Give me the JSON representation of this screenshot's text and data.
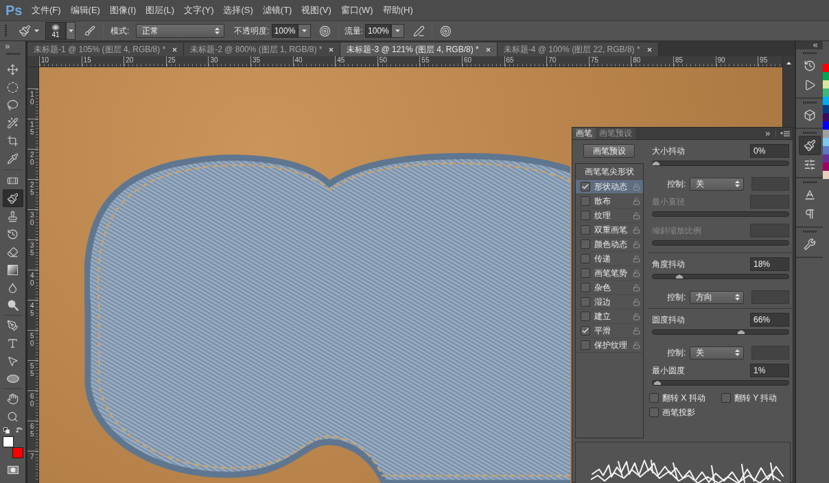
{
  "app": {
    "logo": "Ps"
  },
  "menu": [
    "文件(F)",
    "编辑(E)",
    "图像(I)",
    "图层(L)",
    "文字(Y)",
    "选择(S)",
    "滤镜(T)",
    "视图(V)",
    "窗口(W)",
    "帮助(H)"
  ],
  "options_bar": {
    "brush_size": "41",
    "mode": {
      "label": "模式:",
      "value": "正常"
    },
    "opacity": {
      "label": "不透明度:",
      "value": "100%"
    },
    "flow": {
      "label": "流量:",
      "value": "100%"
    }
  },
  "document_tabs": [
    {
      "title": "未标题-1 @ 105% (图层 4, RGB/8) *",
      "selected": false
    },
    {
      "title": "未标题-2 @ 800% (图层 1, RGB/8) *",
      "selected": false
    },
    {
      "title": "未标题-3 @ 121% (图层 4, RGB/8) *",
      "selected": true
    },
    {
      "title": "未标题-4 @ 100% (图层 22, RGB/8) *",
      "selected": false
    }
  ],
  "rulers": {
    "horizontal": [
      "10",
      "15",
      "20",
      "25",
      "30",
      "35",
      "40",
      "45",
      "50",
      "55",
      "60",
      "65",
      "70",
      "75",
      "80",
      "85",
      "90",
      "95"
    ],
    "vertical": [
      "10",
      "15",
      "20",
      "25",
      "30",
      "35",
      "40",
      "45",
      "50",
      "55",
      "60",
      "65",
      "7"
    ]
  },
  "tool_groups": [
    {
      "tools": [
        {
          "kind": "move",
          "selected": false
        },
        {
          "kind": "marquee",
          "selected": false
        },
        {
          "kind": "lasso",
          "selected": false
        },
        {
          "kind": "quick_selection",
          "selected": false
        },
        {
          "kind": "crop",
          "selected": false
        },
        {
          "kind": "eyedropper",
          "selected": false
        }
      ]
    },
    {
      "tools": [
        {
          "kind": "healing",
          "selected": false
        },
        {
          "kind": "brush",
          "selected": true
        },
        {
          "kind": "stamp",
          "selected": false
        },
        {
          "kind": "history_brush",
          "selected": false
        },
        {
          "kind": "eraser",
          "selected": false
        },
        {
          "kind": "gradient",
          "selected": false
        },
        {
          "kind": "blur",
          "selected": false
        },
        {
          "kind": "dodge",
          "selected": false
        }
      ]
    },
    {
      "tools": [
        {
          "kind": "pen",
          "selected": false
        },
        {
          "kind": "type",
          "selected": false
        },
        {
          "kind": "path_selection",
          "selected": false
        },
        {
          "kind": "ellipse",
          "selected": false
        }
      ]
    },
    {
      "tools": [
        {
          "kind": "hand",
          "selected": false
        },
        {
          "kind": "zoom",
          "selected": false
        }
      ]
    }
  ],
  "colors": {
    "foreground": {
      "color": "#ffffff"
    },
    "background": {
      "color": "#ff0000"
    }
  },
  "dock_groups": [
    {
      "items": [
        {
          "kind": "history",
          "selected": false
        },
        {
          "kind": "actions",
          "selected": false
        }
      ]
    },
    {
      "items": [
        {
          "kind": "model",
          "selected": false
        }
      ]
    },
    {
      "items": [
        {
          "kind": "brush",
          "selected": true
        },
        {
          "kind": "brush_presets",
          "selected": false
        }
      ]
    },
    {
      "items": [
        {
          "kind": "character",
          "selected": false
        },
        {
          "kind": "paragraph",
          "selected": false
        }
      ]
    },
    {
      "items": [
        {
          "kind": "tool_presets",
          "selected": false
        }
      ]
    }
  ],
  "swatches": [
    {
      "color": "#ff0000"
    },
    {
      "color": "#00a650"
    },
    {
      "color": "#d4e8a0"
    },
    {
      "color": "#3cb878"
    },
    {
      "color": "#00aeef"
    },
    {
      "color": "#003f87"
    },
    {
      "color": "#3c0a5e"
    },
    {
      "color": "#0000ff"
    },
    {
      "color": "#a0a0a0"
    },
    {
      "color": "#7dc8f0"
    },
    {
      "color": "#5c78c8"
    },
    {
      "color": "#6a2e9a"
    },
    {
      "color": "#a0005e"
    },
    {
      "color": "#e6d2b8"
    }
  ],
  "brush_panel": {
    "tabs": [
      {
        "label": "画笔",
        "selected": true
      },
      {
        "label": "画笔预设",
        "selected": false
      }
    ],
    "presets_button": "画笔预设",
    "tip_shape": "画笔笔尖形状",
    "options": [
      {
        "label": "形状动态",
        "checked": true,
        "selected": true
      },
      {
        "label": "散布",
        "checked": false,
        "selected": false
      },
      {
        "label": "纹理",
        "checked": false,
        "selected": false
      },
      {
        "label": "双重画笔",
        "checked": false,
        "selected": false
      },
      {
        "label": "颜色动态",
        "checked": false,
        "selected": false
      },
      {
        "label": "传递",
        "checked": false,
        "selected": false
      },
      {
        "label": "画笔笔势",
        "checked": false,
        "selected": false
      },
      {
        "label": "杂色",
        "checked": false,
        "selected": false
      },
      {
        "label": "湿边",
        "checked": false,
        "selected": false
      },
      {
        "label": "建立",
        "checked": false,
        "selected": false
      },
      {
        "label": "平滑",
        "checked": true,
        "selected": false
      },
      {
        "label": "保护纹理",
        "checked": false,
        "selected": false
      }
    ],
    "settings": [
      {
        "kind": "jitter",
        "label": "大小抖动",
        "value": "0%",
        "level": 0,
        "disabled": false
      },
      {
        "kind": "control",
        "label": "控制:",
        "value": "关"
      },
      {
        "kind": "jitter",
        "label": "最小直径",
        "disabled": true
      },
      {
        "kind": "jitter",
        "label": "倾斜缩放比例",
        "disabled": true
      },
      {
        "kind": "divider"
      },
      {
        "kind": "jitter",
        "label": "角度抖动",
        "value": "18%",
        "level": 0.18,
        "disabled": false
      },
      {
        "kind": "control",
        "label": "控制:",
        "value": "方向"
      },
      {
        "kind": "divider"
      },
      {
        "kind": "jitter",
        "label": "圆度抖动",
        "value": "66%",
        "level": 0.66,
        "disabled": false
      },
      {
        "kind": "control",
        "label": "控制:",
        "value": "关"
      },
      {
        "kind": "jitter",
        "label": "最小圆度",
        "value": "1%",
        "level": 0.01,
        "disabled": false
      }
    ],
    "flip_options": [
      {
        "label": "翻转 X 抖动",
        "checked": false
      },
      {
        "label": "翻转 Y 抖动",
        "checked": false
      },
      {
        "label": "画笔投影",
        "checked": false
      }
    ]
  }
}
